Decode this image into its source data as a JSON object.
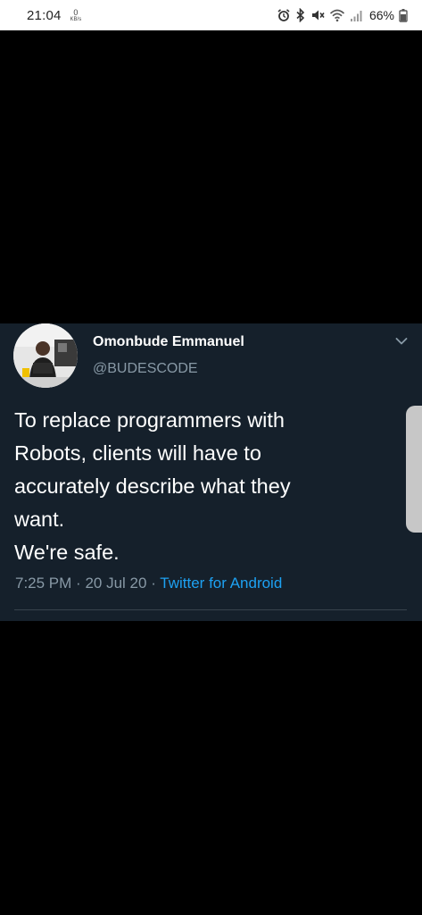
{
  "status_bar": {
    "time": "21:04",
    "net_speed_value": "0",
    "net_speed_unit": "KB/s",
    "battery": "66%",
    "icons": [
      "alarm-icon",
      "bluetooth-icon",
      "mute-icon",
      "wifi-icon",
      "signal-icon",
      "battery-icon"
    ]
  },
  "tweet": {
    "display_name": "Omonbude Emmanuel",
    "handle": "@BUDESCODE",
    "text_lines": [
      "To replace programmers with",
      "Robots, clients will have to",
      "accurately describe what they",
      "want.",
      "We're safe."
    ],
    "time": "7:25 PM",
    "separator": "·",
    "date": "20 Jul 20",
    "source": "Twitter for Android"
  },
  "colors": {
    "background": "#000000",
    "card": "#15202b",
    "secondary_text": "#8899a6",
    "accent": "#1da1f2"
  }
}
